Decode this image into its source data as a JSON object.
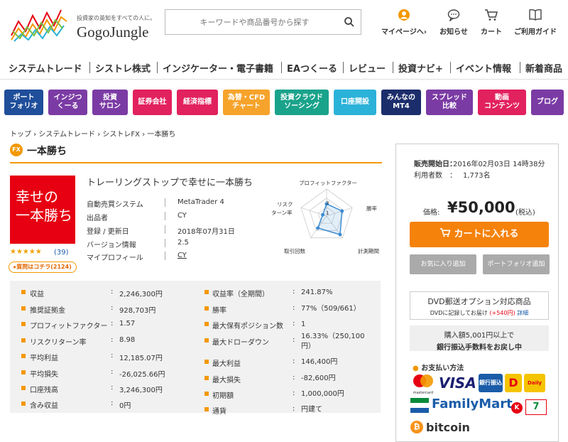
{
  "header": {
    "tagline": "投資家の英知をすべての人に。",
    "logo_name": "GogoJungle",
    "search_placeholder": "キーワードや商品番号から探す",
    "nav": [
      {
        "label": "マイページへ›",
        "icon": "person-icon"
      },
      {
        "label": "お知らせ",
        "icon": "chat-icon"
      },
      {
        "label": "カート",
        "icon": "cart-icon"
      },
      {
        "label": "ご利用ガイド",
        "icon": "book-icon"
      }
    ]
  },
  "main_nav": [
    "システムトレード",
    "シストレ株式",
    "インジケーター・電子書籍",
    "EAつくーる",
    "レビュー",
    "投資ナビ+",
    "イベント情報",
    "新着商品"
  ],
  "categories": [
    {
      "label": "ポート\nフォリオ",
      "color": "#1f4e9a"
    },
    {
      "label": "インジつ\nくーる",
      "color": "#7b3ba4"
    },
    {
      "label": "投資\nサロン",
      "color": "#7b3ba4"
    },
    {
      "label": "証券会社",
      "color": "#e2215f"
    },
    {
      "label": "経済指標",
      "color": "#e2215f"
    },
    {
      "label": "為替・CFD\nチャート",
      "color": "#f6a32b"
    },
    {
      "label": "投資クラウド\nソーシング",
      "color": "#1aa38b"
    },
    {
      "label": "口座開設",
      "color": "#2bb2d9"
    },
    {
      "label": "みんなの\nMT4",
      "color": "#1b2d6b"
    },
    {
      "label": "スプレッド\n比較",
      "color": "#7b3ba4"
    },
    {
      "label": "動画\nコンテンツ",
      "color": "#e2215f"
    },
    {
      "label": "ブログ",
      "color": "#7b3ba4"
    }
  ],
  "breadcrumb": "トップ › システムトレード › シストレFX › 一本勝ち",
  "product": {
    "badge": "FX",
    "title": "一本勝ち",
    "image_text": "幸せの\n一本勝ち",
    "stars": "★★★★★",
    "review_count": "(39)",
    "qa_label": "▸質問はコチラ(2124)",
    "subtitle": "トレーリングストップで幸せに一本勝ち",
    "info": [
      {
        "label": "自動売買システム",
        "value": "MetaTrader 4"
      },
      {
        "label": "出品者",
        "value": "CY"
      },
      {
        "label": "登録 / 更新日",
        "value": "2018年07月31日"
      },
      {
        "label": "バージョン情報",
        "value": "2.5"
      },
      {
        "label": "マイプロフィール",
        "value": "CY"
      }
    ]
  },
  "radar": {
    "labels": [
      "プロフィットファクター",
      "勝率",
      "計測期間",
      "取引回数",
      "リスク\nターン率"
    ],
    "ticks": [
      "3",
      "1"
    ],
    "values": [
      0.45,
      0.6,
      0.85,
      0.55,
      0.15
    ]
  },
  "stats_left": [
    {
      "label": "収益",
      "value": "2,246,300円"
    },
    {
      "label": "推奨証拠金",
      "value": "928,703円"
    },
    {
      "label": "プロフィットファクター",
      "value": "1.57"
    },
    {
      "label": "リスクリターン率",
      "value": "8.98"
    },
    {
      "label": "平均利益",
      "value": "12,185.07円"
    },
    {
      "label": "平均損失",
      "value": "-26,025.66円"
    },
    {
      "label": "口座残高",
      "value": "3,246,300円"
    },
    {
      "label": "含み収益",
      "value": "0円"
    }
  ],
  "stats_right": [
    {
      "label": "収益率（全期間）",
      "value": "241.87%"
    },
    {
      "label": "勝率",
      "value": "77%（509/661）"
    },
    {
      "label": "最大保有ポジション数",
      "value": "1"
    },
    {
      "label": "最大ドローダウン",
      "value": "16.33%（250,100\n円）"
    },
    {
      "label": "最大利益",
      "value": "146,400円"
    },
    {
      "label": "最大損失",
      "value": "-82,600円"
    },
    {
      "label": "初期額",
      "value": "1,000,000円"
    },
    {
      "label": "通貨",
      "value": "円建て"
    }
  ],
  "sidebar": {
    "release_label": "販売開始日：",
    "release_value": "2016年02月03日 14時38分",
    "users_label": "利用者数　：",
    "users_value": "1,773名",
    "price_label": "価格:",
    "price_value": "¥50,000",
    "price_tax": "(税込)",
    "cart_button": "カートに入れる",
    "favorite_button": "お気に入り追加",
    "portfolio_button": "ポートフォリオ追加",
    "dvd_title": "DVD郵送オプション対応商品",
    "dvd_desc": "DVDに記録してお届け",
    "dvd_price": "(+540円)",
    "dvd_link": "詳細",
    "bank_line1": "購入額5,001円以上で",
    "bank_line2": "銀行振込手数料をお戻し中",
    "payment_title": "お支払い方法",
    "payment_logos": [
      "mastercard",
      "VISA",
      "銀行振込",
      "Daily",
      "FamilyMart",
      "bitcoin"
    ]
  }
}
